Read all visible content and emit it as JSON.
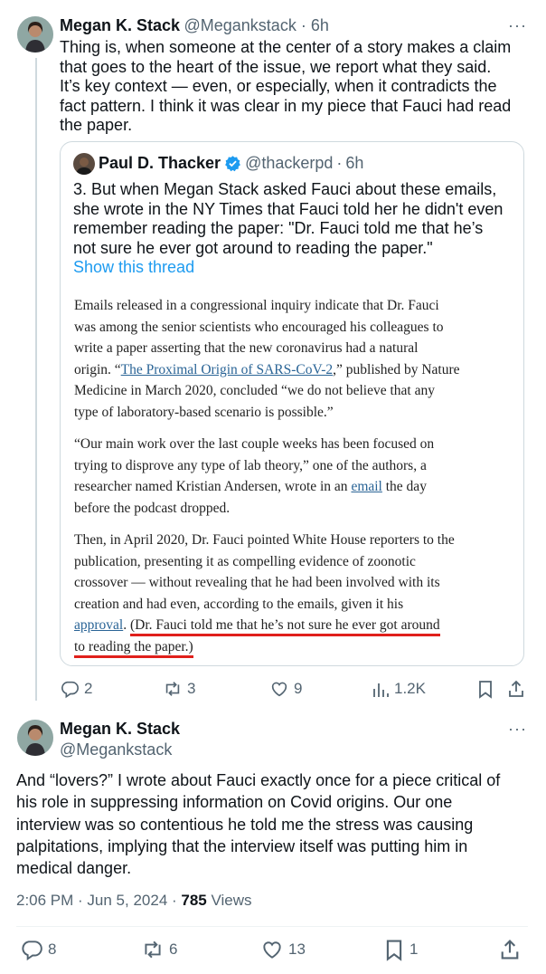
{
  "tweet1": {
    "name": "Megan K. Stack",
    "handle": "@Megankstack",
    "time": "6h",
    "more": "···",
    "lines": [
      "Thing is, when someone at the center of a story makes a claim",
      "that goes to the heart of the issue, we report what they said.",
      "It’s key context — even, or especially, when it contradicts the",
      "fact pattern. I think it was clear in my piece that Fauci had read",
      "the paper."
    ],
    "quote": {
      "name": "Paul D. Thacker",
      "handle": "@thackerpd",
      "time": "6h",
      "lines": [
        "3. But when Megan Stack asked Fauci about these emails,",
        "she wrote in the NY Times that Fauci told her he didn't even",
        "remember reading the paper: \"Dr. Fauci told me that he’s",
        "not sure he ever got around to reading the paper.\""
      ],
      "show_thread": "Show this thread",
      "article": {
        "p1_a": "Emails released in a congressional inquiry indicate that Dr. Fauci",
        "p1_b": "was among the senior scientists who encouraged his colleagues to",
        "p1_c": "write a paper asserting that the new coronavirus had a natural",
        "p1_d_pre": "origin. “",
        "p1_d_link": "The Proximal Origin of SARS-CoV-2",
        "p1_d_post": ",” published by Nature",
        "p1_e": "Medicine in March 2020, concluded “we do not believe that any",
        "p1_f": "type of laboratory-based scenario is possible.”",
        "p2_a": "“Our main work over the last couple weeks has been focused on",
        "p2_b": "trying to disprove any type of lab theory,” one of the authors, a",
        "p2_c_pre": "researcher named Kristian Andersen, wrote in an ",
        "p2_c_link": "email",
        "p2_c_post": " the day",
        "p2_d": "before the podcast dropped.",
        "p3_a": "Then, in April 2020, Dr. Fauci pointed White House reporters to the",
        "p3_b": "publication, presenting it as compelling evidence of zoonotic",
        "p3_c": "crossover — without revealing that he had been involved with its",
        "p3_d": "creation and had even, according to the emails, given it his",
        "p3_e_link": "approval",
        "p3_e_mid": ". ",
        "p3_e_red": "(Dr. Fauci told me that he’s not sure he ever got around",
        "p3_f_red": "to reading the paper.)"
      }
    },
    "actions": {
      "replies": "2",
      "reposts": "3",
      "likes": "9",
      "views": "1.2K"
    }
  },
  "tweet2": {
    "name": "Megan K. Stack",
    "handle": "@Megankstack",
    "more": "···",
    "lines": [
      "And “lovers?” I wrote about Fauci exactly once for a piece critical of",
      "his role in suppressing information on Covid origins. Our one",
      "interview was so contentious he told me the stress was causing",
      "palpitations, implying that the interview itself was putting him in",
      "medical danger."
    ],
    "meta_time": "2:06 PM · Jun 5, 2024 · ",
    "meta_views_count": "785",
    "meta_views_label": " Views",
    "actions": {
      "replies": "8",
      "reposts": "6",
      "likes": "13",
      "bookmarks": "1"
    }
  },
  "colors": {
    "accent": "#1d9bf0",
    "verified": "#1d9bf0",
    "underline_red": "#e0201b",
    "muted": "#536471"
  }
}
